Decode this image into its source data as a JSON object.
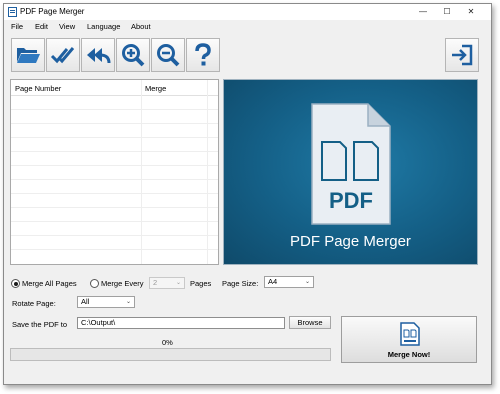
{
  "window": {
    "title": "PDF Page Merger"
  },
  "menu": {
    "items": [
      "File",
      "Edit",
      "View",
      "Language",
      "About"
    ]
  },
  "toolbar": {
    "buttons": [
      "open-folder-icon",
      "check-all-icon",
      "undo-all-icon",
      "zoom-in-icon",
      "zoom-out-icon",
      "help-icon",
      "exit-icon"
    ]
  },
  "list": {
    "columns": [
      "Page Number",
      "Merge"
    ]
  },
  "preview": {
    "file_badge": "PDF",
    "caption": "PDF Page Merger"
  },
  "options": {
    "merge_all_label": "Merge All Pages",
    "merge_every_label": "Merge Every",
    "merge_every_value": "2",
    "pages_label": "Pages",
    "page_size_label": "Page Size:",
    "page_size_value": "A4",
    "rotate_label": "Rotate Page:",
    "rotate_value": "All",
    "save_label": "Save the PDF to",
    "save_path": "C:\\Output\\",
    "browse_label": "Browse"
  },
  "progress": {
    "value": 0,
    "text": "0%"
  },
  "merge_button": {
    "label": "Merge Now!"
  },
  "colors": {
    "accent": "#145f86",
    "icon_blue": "#1e5fa0",
    "progress_fill": "#06b025"
  }
}
